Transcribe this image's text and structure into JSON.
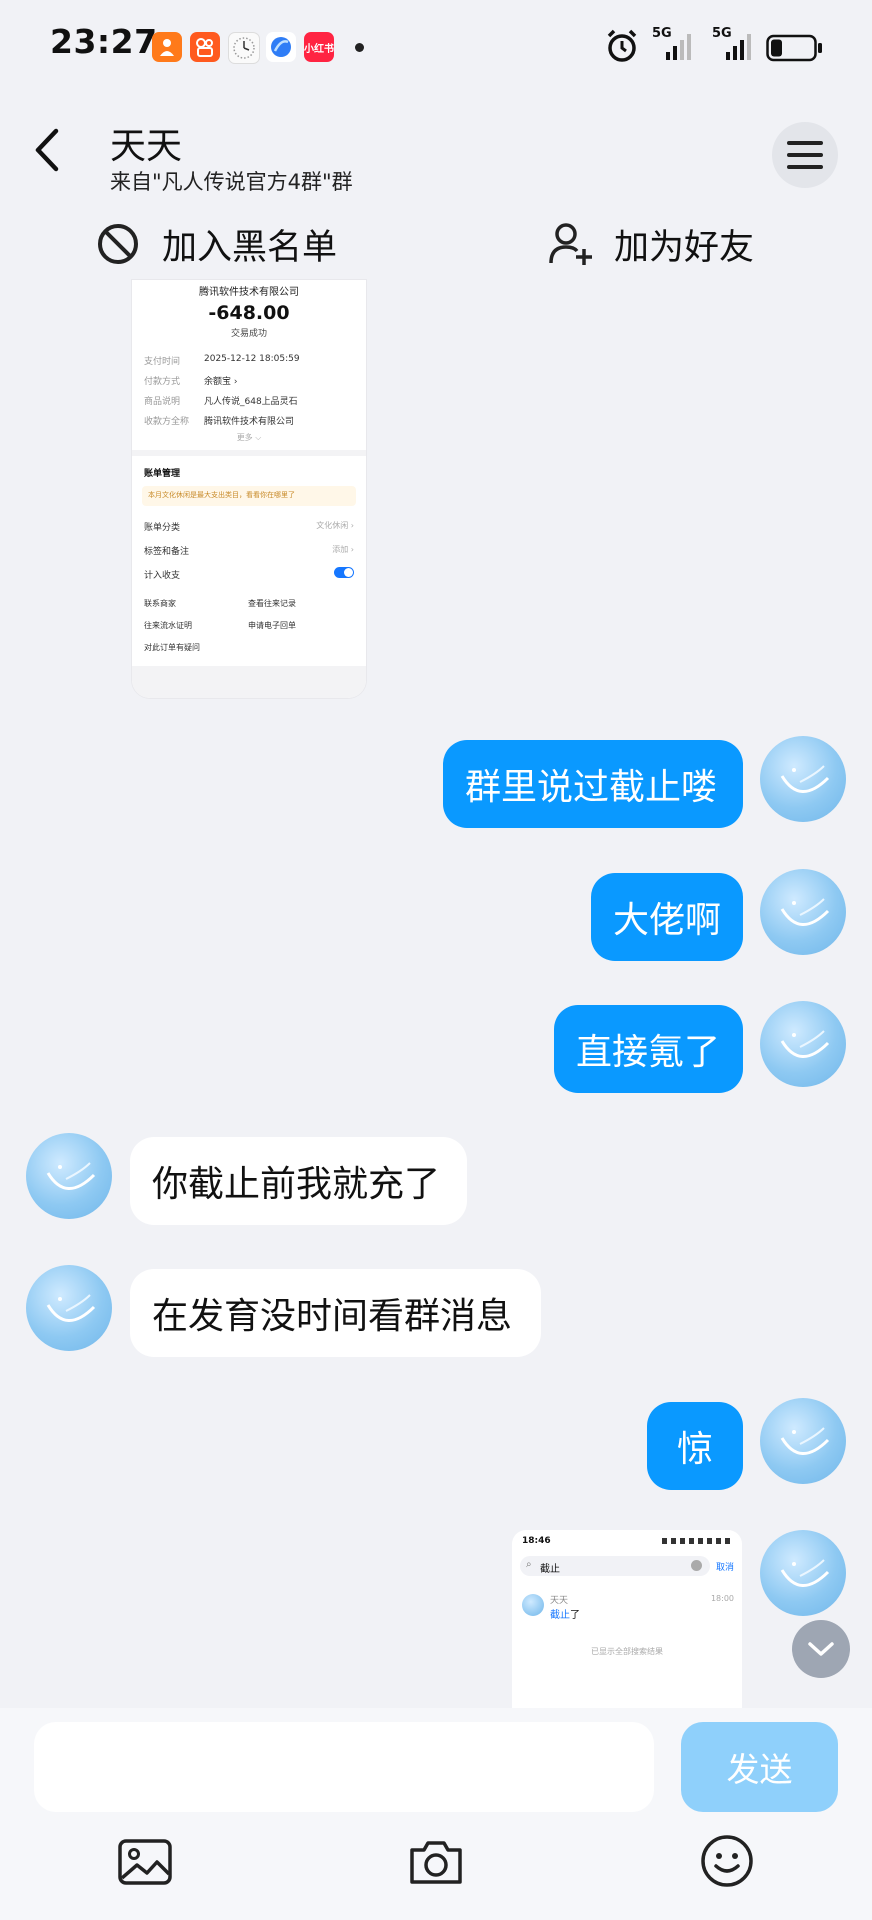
{
  "status": {
    "time": "23:27",
    "app_icons": [
      {
        "name": "app-orange-icon",
        "label": "",
        "color": "#ff7a1a"
      },
      {
        "name": "kuaishou-icon",
        "label": "",
        "color": "#ff5a1f"
      },
      {
        "name": "clock-app-icon",
        "label": "",
        "color": "#ffffff"
      },
      {
        "name": "blue-app-icon",
        "label": "",
        "color": "#2f7df6"
      },
      {
        "name": "xiaohongshu-icon",
        "label": "小红书",
        "color": "#ff2442"
      }
    ],
    "network1": "5G",
    "network2": "5G"
  },
  "header": {
    "title": "天天",
    "subtitle": "来自\"凡人传说官方4群\"群",
    "blacklist_label": "加入黑名单",
    "add_friend_label": "加为好友"
  },
  "receipt": {
    "merchant": "腾讯软件技术有限公司",
    "amount": "-648.00",
    "status": "交易成功",
    "rows": [
      {
        "k": "支付时间",
        "v": "2025-12-12 18:05:59"
      },
      {
        "k": "付款方式",
        "v": "余额宝 ›"
      },
      {
        "k": "商品说明",
        "v": "凡人传说_648上品灵石"
      },
      {
        "k": "收款方全称",
        "v": "腾讯软件技术有限公司"
      }
    ],
    "more": "更多 ⌵",
    "section_title": "账单管理",
    "tip": "本月文化休闲是最大支出类目，看看你在哪里了",
    "options": [
      {
        "k": "账单分类",
        "v": "文化休闲 ›"
      },
      {
        "k": "标签和备注",
        "v": "添加 ›"
      },
      {
        "k": "计入收支",
        "v": ""
      }
    ],
    "links": [
      "联系商家",
      "查看往来记录",
      "往来流水证明",
      "申请电子回单",
      "对此订单有疑问"
    ]
  },
  "messages": [
    {
      "text": "群里说过截止喽",
      "side": "mine"
    },
    {
      "text": "大佬啊",
      "side": "mine"
    },
    {
      "text": "直接氪了",
      "side": "mine"
    },
    {
      "text": "你截止前我就充了",
      "side": "theirs"
    },
    {
      "text": "在发育没时间看群消息",
      "side": "theirs"
    },
    {
      "text": "惊",
      "side": "mine"
    }
  ],
  "thumb": {
    "time": "18:46",
    "search": "截止",
    "cancel": "取消",
    "name": "天天",
    "msg_hl": "截止",
    "msg_rest": "了",
    "msg_time": "18:00",
    "footer": "已显示全部搜索结果"
  },
  "composer": {
    "input_placeholder": "",
    "send_label": "发送"
  },
  "colors": {
    "accent": "#0a99ff",
    "send_disabled": "#8fd0fb",
    "background": "#f1f2f6"
  }
}
